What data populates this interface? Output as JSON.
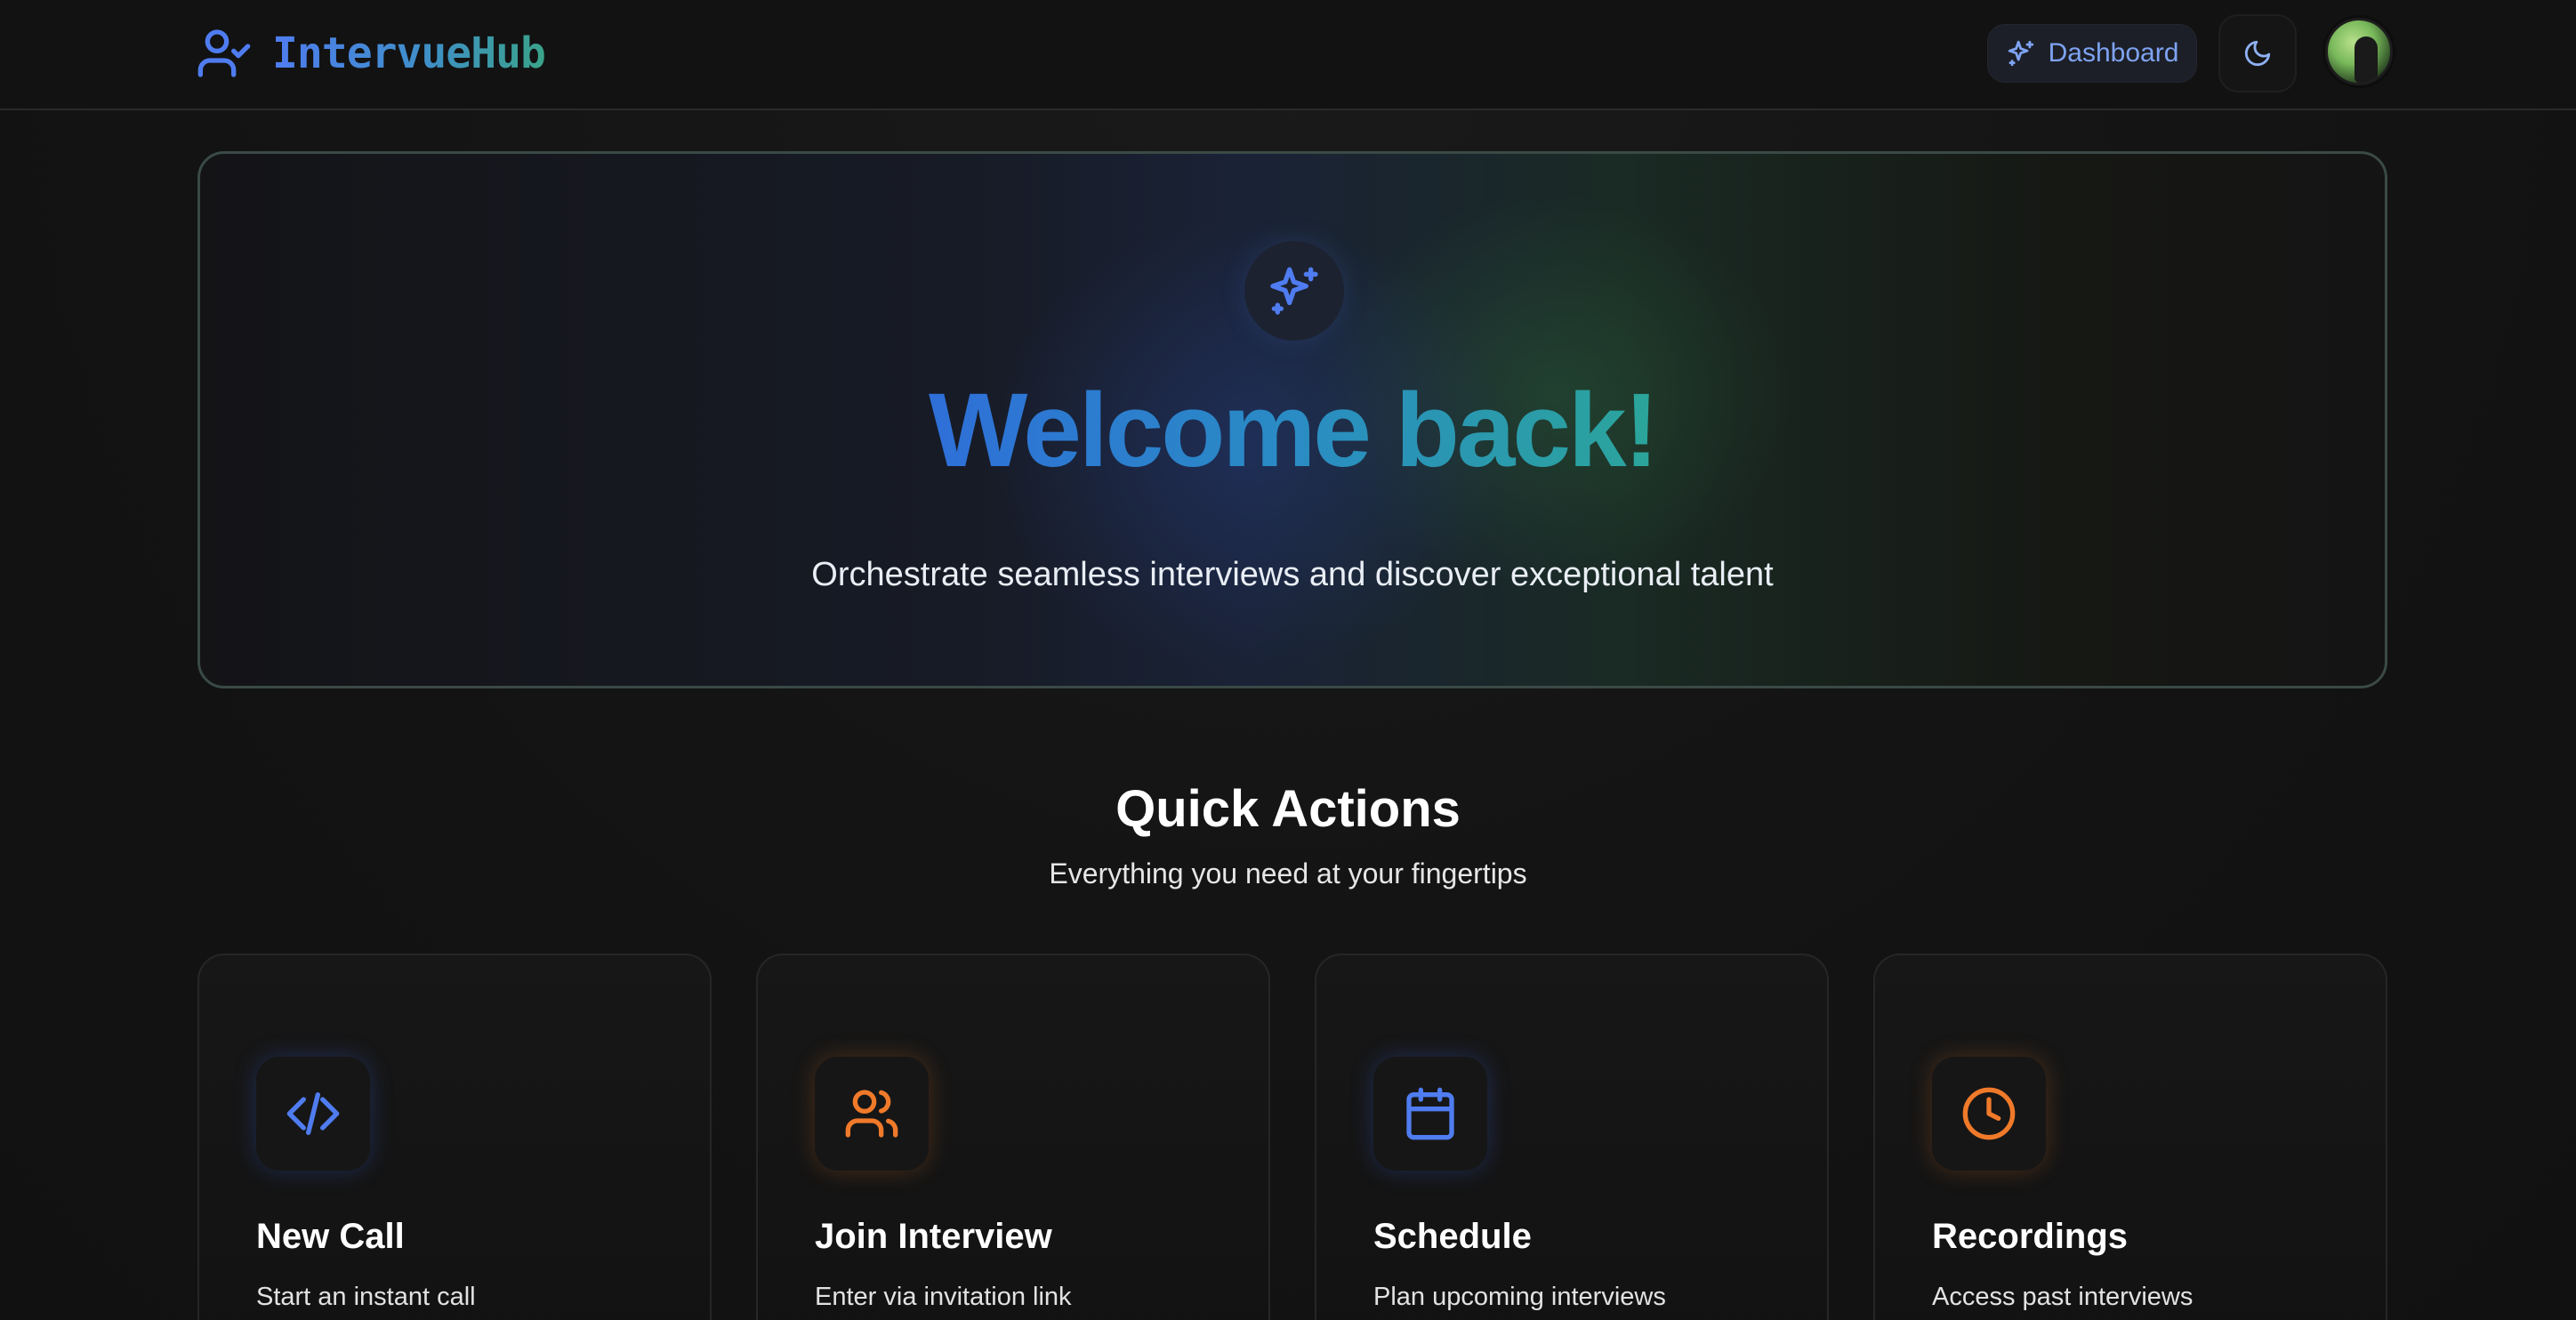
{
  "header": {
    "brand": "IntervueHub",
    "dashboard_label": "Dashboard"
  },
  "hero": {
    "title": "Welcome back!",
    "subtitle": "Orchestrate seamless interviews and discover exceptional talent"
  },
  "quick_actions": {
    "title": "Quick Actions",
    "subtitle": "Everything you need at your fingertips",
    "cards": [
      {
        "title": "New Call",
        "description": "Start an instant call",
        "icon": "code-icon",
        "accent": "#4f7cf0"
      },
      {
        "title": "Join Interview",
        "description": "Enter via invitation link",
        "icon": "users-icon",
        "accent": "#f07a2a"
      },
      {
        "title": "Schedule",
        "description": "Plan upcoming interviews",
        "icon": "calendar-icon",
        "accent": "#4f7cf0"
      },
      {
        "title": "Recordings",
        "description": "Access past interviews",
        "icon": "clock-icon",
        "accent": "#f07a2a"
      }
    ]
  },
  "colors": {
    "blue_accent": "#4f7cf0",
    "orange_accent": "#f07a2a",
    "teal_accent": "#2ba59a",
    "background": "#141414"
  }
}
